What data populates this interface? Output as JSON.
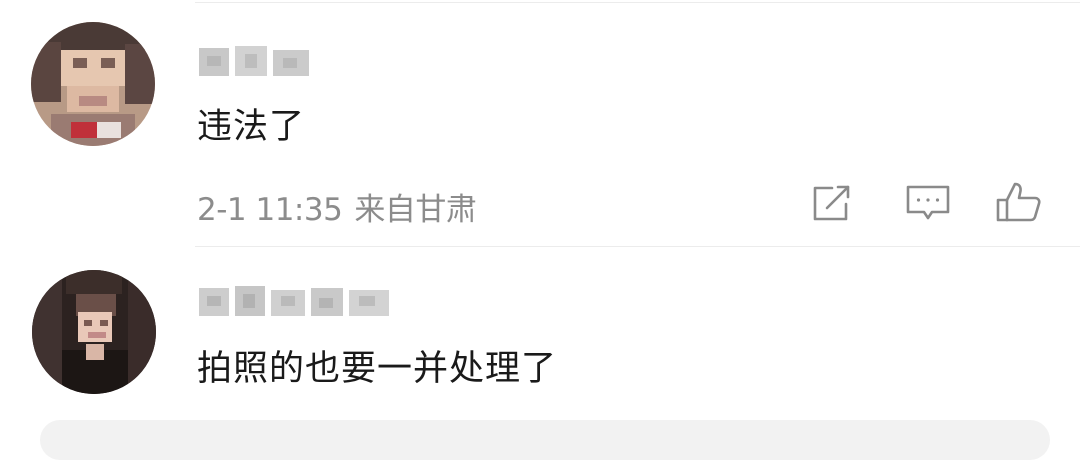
{
  "comments": [
    {
      "username": "",
      "text": "违法了",
      "time": "2-1 11:35",
      "location": "来自甘肃",
      "actions": [
        "share-icon",
        "reply-icon",
        "like-icon"
      ]
    },
    {
      "username": "",
      "text": "拍照的也要一并处理了"
    }
  ],
  "colors": {
    "text": "#1a1a1a",
    "meta": "#8c8c8c",
    "icon": "#8a8a8a",
    "divider": "#ececec",
    "blur": "#c8c8c8"
  }
}
